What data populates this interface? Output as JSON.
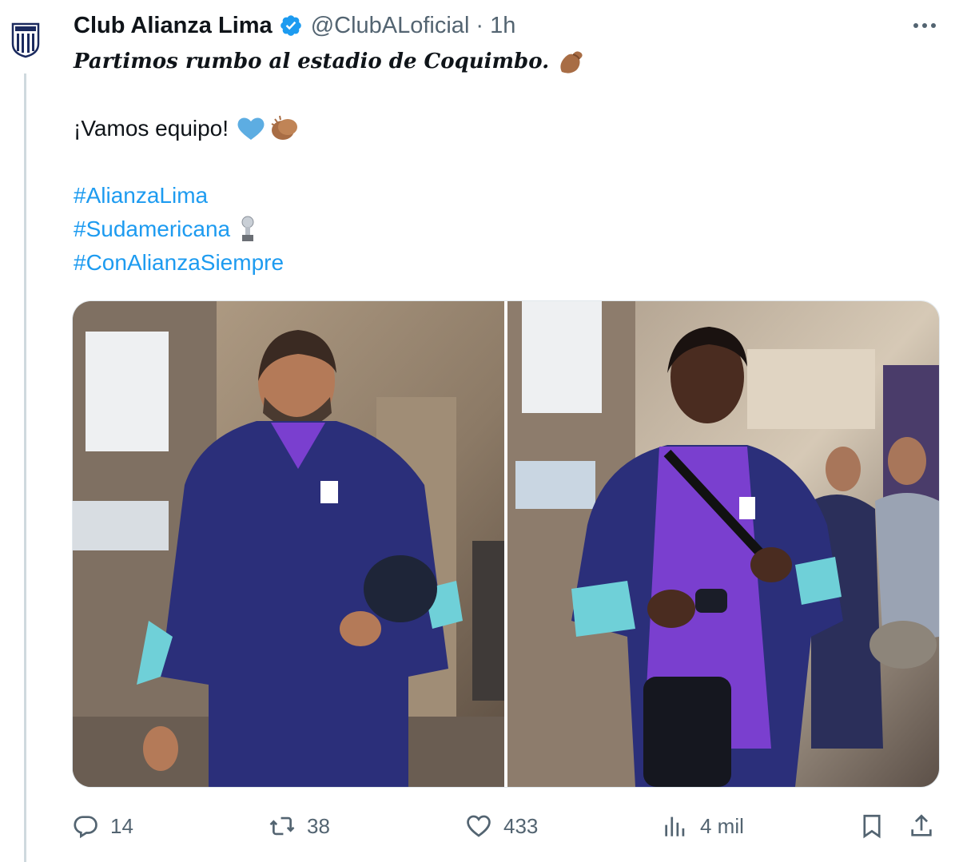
{
  "author": {
    "name": "Club Alianza Lima",
    "handle": "@ClubALoficial",
    "separator": "·",
    "time": "1h",
    "verified": true,
    "avatar_icon": "alianza-lima-crest"
  },
  "tweet": {
    "line1": "Partimos rumbo al estadio de Coquimbo.",
    "line1_emoji": "flexed-biceps",
    "line2": "¡Vamos equipo!",
    "line2_emojis": [
      "blue-heart",
      "clapping-hands"
    ],
    "hashtags": [
      {
        "text": "#AlianzaLima"
      },
      {
        "text": "#Sudamericana",
        "emoji": "trophy"
      },
      {
        "text": "#ConAlianzaSiempre"
      }
    ]
  },
  "media": {
    "count": 2,
    "descriptions": [
      "player-purple-jacket-holding-bag",
      "player-with-shoulder-bag"
    ]
  },
  "actions": {
    "replies": "14",
    "reposts": "38",
    "likes": "433",
    "views": "4 mil"
  },
  "colors": {
    "link": "#1d9bf0",
    "secondary": "#536471",
    "verified": "#1d9bf0",
    "jacket": "#2b2f7a",
    "shirt": "#7a3fcf",
    "sleeve": "#6fd0d8"
  }
}
